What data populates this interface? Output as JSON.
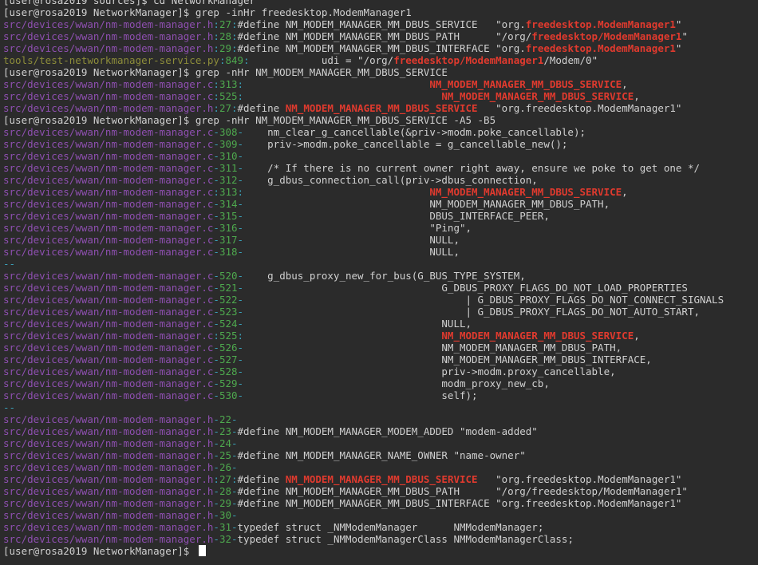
{
  "terminal": {
    "background": "#2b2b2b",
    "colors": {
      "file_path": "#8e4fb0",
      "tools_path": "#8d8d3a",
      "line_number": "#4ea84e",
      "separator": "#3aa0b8",
      "match": "#e03a2e",
      "text": "#d0d0d0"
    },
    "cursor_prompt": "[user@rosa2019 NetworkManager]$ ",
    "lines": [
      [
        {
          "t": "[user@rosa2019 sources]$ cd NetworkManager",
          "c": "text"
        }
      ],
      [
        {
          "t": "[user@rosa2019 NetworkManager]$ grep -inHr freedesktop.ModemManager1",
          "c": "text"
        }
      ],
      [
        {
          "t": "src/devices/wwan/nm-modem-manager.h",
          "c": "file"
        },
        {
          "t": ":",
          "c": "sep"
        },
        {
          "t": "27",
          "c": "num"
        },
        {
          "t": ":",
          "c": "sep"
        },
        {
          "t": "#define NM_MODEM_MANAGER_MM_DBUS_SERVICE   \"org.",
          "c": "text"
        },
        {
          "t": "freedesktop.ModemManager1",
          "c": "match"
        },
        {
          "t": "\"",
          "c": "text"
        }
      ],
      [
        {
          "t": "src/devices/wwan/nm-modem-manager.h",
          "c": "file"
        },
        {
          "t": ":",
          "c": "sep"
        },
        {
          "t": "28",
          "c": "num"
        },
        {
          "t": ":",
          "c": "sep"
        },
        {
          "t": "#define NM_MODEM_MANAGER_MM_DBUS_PATH      \"/org/",
          "c": "text"
        },
        {
          "t": "freedesktop/ModemManager1",
          "c": "match"
        },
        {
          "t": "\"",
          "c": "text"
        }
      ],
      [
        {
          "t": "src/devices/wwan/nm-modem-manager.h",
          "c": "file"
        },
        {
          "t": ":",
          "c": "sep"
        },
        {
          "t": "29",
          "c": "num"
        },
        {
          "t": ":",
          "c": "sep"
        },
        {
          "t": "#define NM_MODEM_MANAGER_MM_DBUS_INTERFACE \"org.",
          "c": "text"
        },
        {
          "t": "freedesktop.ModemManager1",
          "c": "match"
        },
        {
          "t": "\"",
          "c": "text"
        }
      ],
      [
        {
          "t": "tools/test-networkmanager-service.py",
          "c": "tool"
        },
        {
          "t": ":",
          "c": "sep"
        },
        {
          "t": "849",
          "c": "num"
        },
        {
          "t": ":",
          "c": "sep"
        },
        {
          "t": "            udi = \"/org/",
          "c": "text"
        },
        {
          "t": "freedesktop/ModemManager1",
          "c": "match"
        },
        {
          "t": "/Modem/0\"",
          "c": "text"
        }
      ],
      [
        {
          "t": "[user@rosa2019 NetworkManager]$ grep -nHr NM_MODEM_MANAGER_MM_DBUS_SERVICE",
          "c": "text"
        }
      ],
      [
        {
          "t": "src/devices/wwan/nm-modem-manager.c",
          "c": "file"
        },
        {
          "t": ":",
          "c": "sep"
        },
        {
          "t": "313",
          "c": "num"
        },
        {
          "t": ":",
          "c": "sep"
        },
        {
          "t": "                               ",
          "c": "text"
        },
        {
          "t": "NM_MODEM_MANAGER_MM_DBUS_SERVICE",
          "c": "match"
        },
        {
          "t": ",",
          "c": "text"
        }
      ],
      [
        {
          "t": "src/devices/wwan/nm-modem-manager.c",
          "c": "file"
        },
        {
          "t": ":",
          "c": "sep"
        },
        {
          "t": "525",
          "c": "num"
        },
        {
          "t": ":",
          "c": "sep"
        },
        {
          "t": "                                 ",
          "c": "text"
        },
        {
          "t": "NM_MODEM_MANAGER_MM_DBUS_SERVICE",
          "c": "match"
        },
        {
          "t": ",",
          "c": "text"
        }
      ],
      [
        {
          "t": "src/devices/wwan/nm-modem-manager.h",
          "c": "file"
        },
        {
          "t": ":",
          "c": "sep"
        },
        {
          "t": "27",
          "c": "num"
        },
        {
          "t": ":",
          "c": "sep"
        },
        {
          "t": "#define ",
          "c": "text"
        },
        {
          "t": "NM_MODEM_MANAGER_MM_DBUS_SERVICE",
          "c": "match"
        },
        {
          "t": "   \"org.freedesktop.ModemManager1\"",
          "c": "text"
        }
      ],
      [
        {
          "t": "[user@rosa2019 NetworkManager]$ grep -nHr NM_MODEM_MANAGER_MM_DBUS_SERVICE -A5 -B5",
          "c": "text"
        }
      ],
      [
        {
          "t": "src/devices/wwan/nm-modem-manager.c",
          "c": "file"
        },
        {
          "t": "-",
          "c": "sep"
        },
        {
          "t": "308",
          "c": "num"
        },
        {
          "t": "-",
          "c": "sep"
        },
        {
          "t": "    nm_clear_g_cancellable(&priv->modm.poke_cancellable);",
          "c": "text"
        }
      ],
      [
        {
          "t": "src/devices/wwan/nm-modem-manager.c",
          "c": "file"
        },
        {
          "t": "-",
          "c": "sep"
        },
        {
          "t": "309",
          "c": "num"
        },
        {
          "t": "-",
          "c": "sep"
        },
        {
          "t": "    priv->modm.poke_cancellable = g_cancellable_new();",
          "c": "text"
        }
      ],
      [
        {
          "t": "src/devices/wwan/nm-modem-manager.c",
          "c": "file"
        },
        {
          "t": "-",
          "c": "sep"
        },
        {
          "t": "310",
          "c": "num"
        },
        {
          "t": "-",
          "c": "sep"
        }
      ],
      [
        {
          "t": "src/devices/wwan/nm-modem-manager.c",
          "c": "file"
        },
        {
          "t": "-",
          "c": "sep"
        },
        {
          "t": "311",
          "c": "num"
        },
        {
          "t": "-",
          "c": "sep"
        },
        {
          "t": "    /* If there is no current owner right away, ensure we poke to get one */",
          "c": "text"
        }
      ],
      [
        {
          "t": "src/devices/wwan/nm-modem-manager.c",
          "c": "file"
        },
        {
          "t": "-",
          "c": "sep"
        },
        {
          "t": "312",
          "c": "num"
        },
        {
          "t": "-",
          "c": "sep"
        },
        {
          "t": "    g_dbus_connection_call(priv->dbus_connection,",
          "c": "text"
        }
      ],
      [
        {
          "t": "src/devices/wwan/nm-modem-manager.c",
          "c": "file"
        },
        {
          "t": ":",
          "c": "sep"
        },
        {
          "t": "313",
          "c": "num"
        },
        {
          "t": ":",
          "c": "sep"
        },
        {
          "t": "                               ",
          "c": "text"
        },
        {
          "t": "NM_MODEM_MANAGER_MM_DBUS_SERVICE",
          "c": "match"
        },
        {
          "t": ",",
          "c": "text"
        }
      ],
      [
        {
          "t": "src/devices/wwan/nm-modem-manager.c",
          "c": "file"
        },
        {
          "t": "-",
          "c": "sep"
        },
        {
          "t": "314",
          "c": "num"
        },
        {
          "t": "-",
          "c": "sep"
        },
        {
          "t": "                               NM_MODEM_MANAGER_MM_DBUS_PATH,",
          "c": "text"
        }
      ],
      [
        {
          "t": "src/devices/wwan/nm-modem-manager.c",
          "c": "file"
        },
        {
          "t": "-",
          "c": "sep"
        },
        {
          "t": "315",
          "c": "num"
        },
        {
          "t": "-",
          "c": "sep"
        },
        {
          "t": "                               DBUS_INTERFACE_PEER,",
          "c": "text"
        }
      ],
      [
        {
          "t": "src/devices/wwan/nm-modem-manager.c",
          "c": "file"
        },
        {
          "t": "-",
          "c": "sep"
        },
        {
          "t": "316",
          "c": "num"
        },
        {
          "t": "-",
          "c": "sep"
        },
        {
          "t": "                               \"Ping\",",
          "c": "text"
        }
      ],
      [
        {
          "t": "src/devices/wwan/nm-modem-manager.c",
          "c": "file"
        },
        {
          "t": "-",
          "c": "sep"
        },
        {
          "t": "317",
          "c": "num"
        },
        {
          "t": "-",
          "c": "sep"
        },
        {
          "t": "                               NULL,",
          "c": "text"
        }
      ],
      [
        {
          "t": "src/devices/wwan/nm-modem-manager.c",
          "c": "file"
        },
        {
          "t": "-",
          "c": "sep"
        },
        {
          "t": "318",
          "c": "num"
        },
        {
          "t": "-",
          "c": "sep"
        },
        {
          "t": "                               NULL,",
          "c": "text"
        }
      ],
      [
        {
          "t": "--",
          "c": "ctx"
        }
      ],
      [
        {
          "t": "src/devices/wwan/nm-modem-manager.c",
          "c": "file"
        },
        {
          "t": "-",
          "c": "sep"
        },
        {
          "t": "520",
          "c": "num"
        },
        {
          "t": "-",
          "c": "sep"
        },
        {
          "t": "    g_dbus_proxy_new_for_bus(G_BUS_TYPE_SYSTEM,",
          "c": "text"
        }
      ],
      [
        {
          "t": "src/devices/wwan/nm-modem-manager.c",
          "c": "file"
        },
        {
          "t": "-",
          "c": "sep"
        },
        {
          "t": "521",
          "c": "num"
        },
        {
          "t": "-",
          "c": "sep"
        },
        {
          "t": "                                 G_DBUS_PROXY_FLAGS_DO_NOT_LOAD_PROPERTIES",
          "c": "text"
        }
      ],
      [
        {
          "t": "src/devices/wwan/nm-modem-manager.c",
          "c": "file"
        },
        {
          "t": "-",
          "c": "sep"
        },
        {
          "t": "522",
          "c": "num"
        },
        {
          "t": "-",
          "c": "sep"
        },
        {
          "t": "                                     | G_DBUS_PROXY_FLAGS_DO_NOT_CONNECT_SIGNALS",
          "c": "text"
        }
      ],
      [
        {
          "t": "src/devices/wwan/nm-modem-manager.c",
          "c": "file"
        },
        {
          "t": "-",
          "c": "sep"
        },
        {
          "t": "523",
          "c": "num"
        },
        {
          "t": "-",
          "c": "sep"
        },
        {
          "t": "                                     | G_DBUS_PROXY_FLAGS_DO_NOT_AUTO_START,",
          "c": "text"
        }
      ],
      [
        {
          "t": "src/devices/wwan/nm-modem-manager.c",
          "c": "file"
        },
        {
          "t": "-",
          "c": "sep"
        },
        {
          "t": "524",
          "c": "num"
        },
        {
          "t": "-",
          "c": "sep"
        },
        {
          "t": "                                 NULL,",
          "c": "text"
        }
      ],
      [
        {
          "t": "src/devices/wwan/nm-modem-manager.c",
          "c": "file"
        },
        {
          "t": ":",
          "c": "sep"
        },
        {
          "t": "525",
          "c": "num"
        },
        {
          "t": ":",
          "c": "sep"
        },
        {
          "t": "                                 ",
          "c": "text"
        },
        {
          "t": "NM_MODEM_MANAGER_MM_DBUS_SERVICE",
          "c": "match"
        },
        {
          "t": ",",
          "c": "text"
        }
      ],
      [
        {
          "t": "src/devices/wwan/nm-modem-manager.c",
          "c": "file"
        },
        {
          "t": "-",
          "c": "sep"
        },
        {
          "t": "526",
          "c": "num"
        },
        {
          "t": "-",
          "c": "sep"
        },
        {
          "t": "                                 NM_MODEM_MANAGER_MM_DBUS_PATH,",
          "c": "text"
        }
      ],
      [
        {
          "t": "src/devices/wwan/nm-modem-manager.c",
          "c": "file"
        },
        {
          "t": "-",
          "c": "sep"
        },
        {
          "t": "527",
          "c": "num"
        },
        {
          "t": "-",
          "c": "sep"
        },
        {
          "t": "                                 NM_MODEM_MANAGER_MM_DBUS_INTERFACE,",
          "c": "text"
        }
      ],
      [
        {
          "t": "src/devices/wwan/nm-modem-manager.c",
          "c": "file"
        },
        {
          "t": "-",
          "c": "sep"
        },
        {
          "t": "528",
          "c": "num"
        },
        {
          "t": "-",
          "c": "sep"
        },
        {
          "t": "                                 priv->modm.proxy_cancellable,",
          "c": "text"
        }
      ],
      [
        {
          "t": "src/devices/wwan/nm-modem-manager.c",
          "c": "file"
        },
        {
          "t": "-",
          "c": "sep"
        },
        {
          "t": "529",
          "c": "num"
        },
        {
          "t": "-",
          "c": "sep"
        },
        {
          "t": "                                 modm_proxy_new_cb,",
          "c": "text"
        }
      ],
      [
        {
          "t": "src/devices/wwan/nm-modem-manager.c",
          "c": "file"
        },
        {
          "t": "-",
          "c": "sep"
        },
        {
          "t": "530",
          "c": "num"
        },
        {
          "t": "-",
          "c": "sep"
        },
        {
          "t": "                                 self);",
          "c": "text"
        }
      ],
      [
        {
          "t": "--",
          "c": "ctx"
        }
      ],
      [
        {
          "t": "src/devices/wwan/nm-modem-manager.h",
          "c": "file"
        },
        {
          "t": "-",
          "c": "sep"
        },
        {
          "t": "22",
          "c": "num"
        },
        {
          "t": "-",
          "c": "sep"
        }
      ],
      [
        {
          "t": "src/devices/wwan/nm-modem-manager.h",
          "c": "file"
        },
        {
          "t": "-",
          "c": "sep"
        },
        {
          "t": "23",
          "c": "num"
        },
        {
          "t": "-",
          "c": "sep"
        },
        {
          "t": "#define NM_MODEM_MANAGER_MODEM_ADDED \"modem-added\"",
          "c": "text"
        }
      ],
      [
        {
          "t": "src/devices/wwan/nm-modem-manager.h",
          "c": "file"
        },
        {
          "t": "-",
          "c": "sep"
        },
        {
          "t": "24",
          "c": "num"
        },
        {
          "t": "-",
          "c": "sep"
        }
      ],
      [
        {
          "t": "src/devices/wwan/nm-modem-manager.h",
          "c": "file"
        },
        {
          "t": "-",
          "c": "sep"
        },
        {
          "t": "25",
          "c": "num"
        },
        {
          "t": "-",
          "c": "sep"
        },
        {
          "t": "#define NM_MODEM_MANAGER_NAME_OWNER \"name-owner\"",
          "c": "text"
        }
      ],
      [
        {
          "t": "src/devices/wwan/nm-modem-manager.h",
          "c": "file"
        },
        {
          "t": "-",
          "c": "sep"
        },
        {
          "t": "26",
          "c": "num"
        },
        {
          "t": "-",
          "c": "sep"
        }
      ],
      [
        {
          "t": "src/devices/wwan/nm-modem-manager.h",
          "c": "file"
        },
        {
          "t": ":",
          "c": "sep"
        },
        {
          "t": "27",
          "c": "num"
        },
        {
          "t": ":",
          "c": "sep"
        },
        {
          "t": "#define ",
          "c": "text"
        },
        {
          "t": "NM_MODEM_MANAGER_MM_DBUS_SERVICE",
          "c": "match"
        },
        {
          "t": "   \"org.freedesktop.ModemManager1\"",
          "c": "text"
        }
      ],
      [
        {
          "t": "src/devices/wwan/nm-modem-manager.h",
          "c": "file"
        },
        {
          "t": "-",
          "c": "sep"
        },
        {
          "t": "28",
          "c": "num"
        },
        {
          "t": "-",
          "c": "sep"
        },
        {
          "t": "#define NM_MODEM_MANAGER_MM_DBUS_PATH      \"/org/freedesktop/ModemManager1\"",
          "c": "text"
        }
      ],
      [
        {
          "t": "src/devices/wwan/nm-modem-manager.h",
          "c": "file"
        },
        {
          "t": "-",
          "c": "sep"
        },
        {
          "t": "29",
          "c": "num"
        },
        {
          "t": "-",
          "c": "sep"
        },
        {
          "t": "#define NM_MODEM_MANAGER_MM_DBUS_INTERFACE \"org.freedesktop.ModemManager1\"",
          "c": "text"
        }
      ],
      [
        {
          "t": "src/devices/wwan/nm-modem-manager.h",
          "c": "file"
        },
        {
          "t": "-",
          "c": "sep"
        },
        {
          "t": "30",
          "c": "num"
        },
        {
          "t": "-",
          "c": "sep"
        }
      ],
      [
        {
          "t": "src/devices/wwan/nm-modem-manager.h",
          "c": "file"
        },
        {
          "t": "-",
          "c": "sep"
        },
        {
          "t": "31",
          "c": "num"
        },
        {
          "t": "-",
          "c": "sep"
        },
        {
          "t": "typedef struct _NMModemManager      NMModemManager;",
          "c": "text"
        }
      ],
      [
        {
          "t": "src/devices/wwan/nm-modem-manager.h",
          "c": "file"
        },
        {
          "t": "-",
          "c": "sep"
        },
        {
          "t": "32",
          "c": "num"
        },
        {
          "t": "-",
          "c": "sep"
        },
        {
          "t": "typedef struct _NMModemManagerClass NMModemManagerClass;",
          "c": "text"
        }
      ]
    ]
  }
}
